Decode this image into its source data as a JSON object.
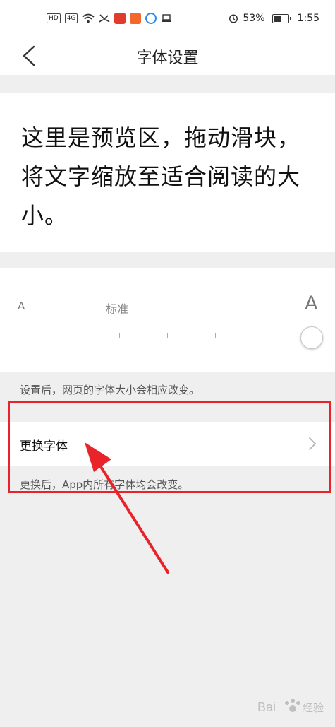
{
  "status_bar": {
    "net_label": "HD",
    "signal_label": "4G",
    "battery_percent": "53%",
    "time": "1:55",
    "battery_fill": 0.53
  },
  "header": {
    "title": "字体设置",
    "back_icon": "chevron-left-icon"
  },
  "preview": {
    "text": "这里是预览区，拖动滑块，将文字缩放至适合阅读的大小。"
  },
  "font_size_slider": {
    "small_label": "A",
    "standard_label": "标准",
    "large_label": "A",
    "steps": 7,
    "selected_step": 6
  },
  "hints": {
    "size_hint": "设置后，网页的字体大小会相应改变。",
    "font_hint": "更换后，App内所有字体均会改变。"
  },
  "change_font": {
    "label": "更换字体",
    "chevron_icon": "chevron-right-icon"
  },
  "annotation": {
    "color": "#e8232a"
  },
  "watermark": {
    "text": "Bai 经验"
  }
}
